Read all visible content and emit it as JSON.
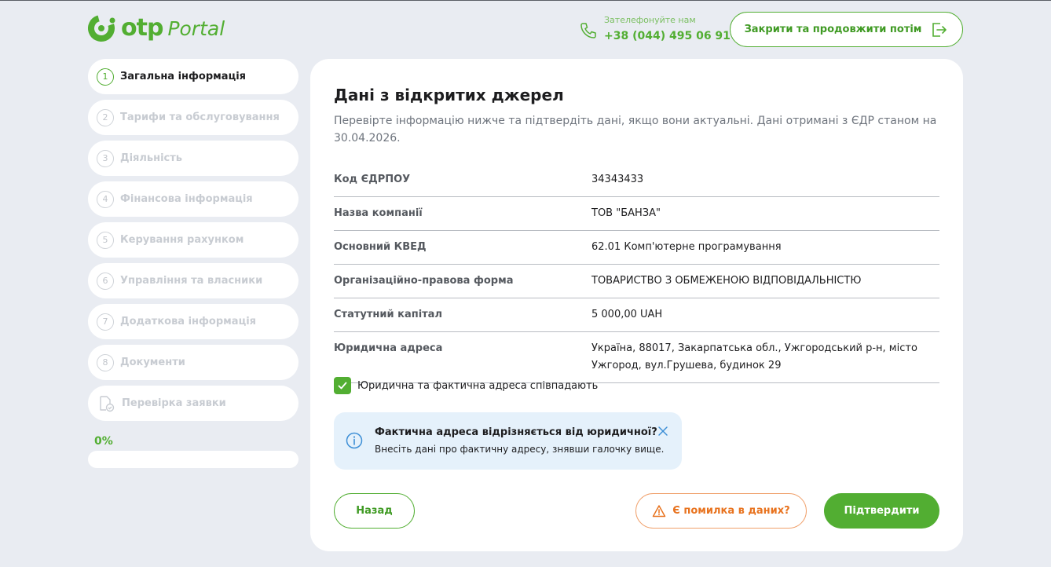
{
  "header": {
    "logo_text": "otp",
    "logo_sub": "Portal",
    "phone_label": "Зателефонуйте нам",
    "phone_number": "+38 (044) 495 06 91",
    "close_button": "Закрити та продовжити потім"
  },
  "sidebar": {
    "steps": [
      {
        "num": "1",
        "label": "Загальна інформація"
      },
      {
        "num": "2",
        "label": "Тарифи та обслуговування"
      },
      {
        "num": "3",
        "label": "Діяльність"
      },
      {
        "num": "4",
        "label": "Фінансова інформація"
      },
      {
        "num": "5",
        "label": "Керування рахунком"
      },
      {
        "num": "6",
        "label": "Управління та власники"
      },
      {
        "num": "7",
        "label": "Додаткова інформація"
      },
      {
        "num": "8",
        "label": "Документи"
      }
    ],
    "review_label": "Перевірка заявки",
    "progress_text": "0%",
    "progress_value": 0
  },
  "main": {
    "title": "Дані з відкритих джерел",
    "description": "Перевірте інформацію нижче та підтвердіть дані, якщо вони актуальні. Дані отримані з ЄДР станом на 30.04.2026.",
    "rows": [
      {
        "key": "Код ЄДРПОУ",
        "value": "34343433"
      },
      {
        "key": "Назва компанії",
        "value": "ТОВ \"БАНЗА\""
      },
      {
        "key": "Основний КВЕД",
        "value": "62.01 Комп'ютерне програмування"
      },
      {
        "key": "Організаційно-правова форма",
        "value": "ТОВАРИСТВО З ОБМЕЖЕНОЮ ВІДПОВІДАЛЬНІСТЮ"
      },
      {
        "key": "Статутний капітал",
        "value": "5 000,00 UAH"
      },
      {
        "key": "Юридична адреса",
        "value": "Україна, 88017, Закарпатська обл., Ужгородський р-н, місто Ужгород, вул.Грушева, будинок 29"
      }
    ],
    "checkbox_label": "Юридична та фактична адреса співпадають",
    "checkbox_checked": true,
    "notice": {
      "title": "Фактична адреса відрізняється від юридичної?",
      "text": "Внесіть дані про фактичну адресу, знявши галочку вище."
    },
    "buttons": {
      "back": "Назад",
      "error": "Є помилка в даних?",
      "confirm": "Підтвердити"
    }
  },
  "colors": {
    "brand_green": "#52ae32",
    "background": "#e9ecf2",
    "warning_orange": "#e8731f",
    "notice_bg": "#e5f1fb"
  }
}
